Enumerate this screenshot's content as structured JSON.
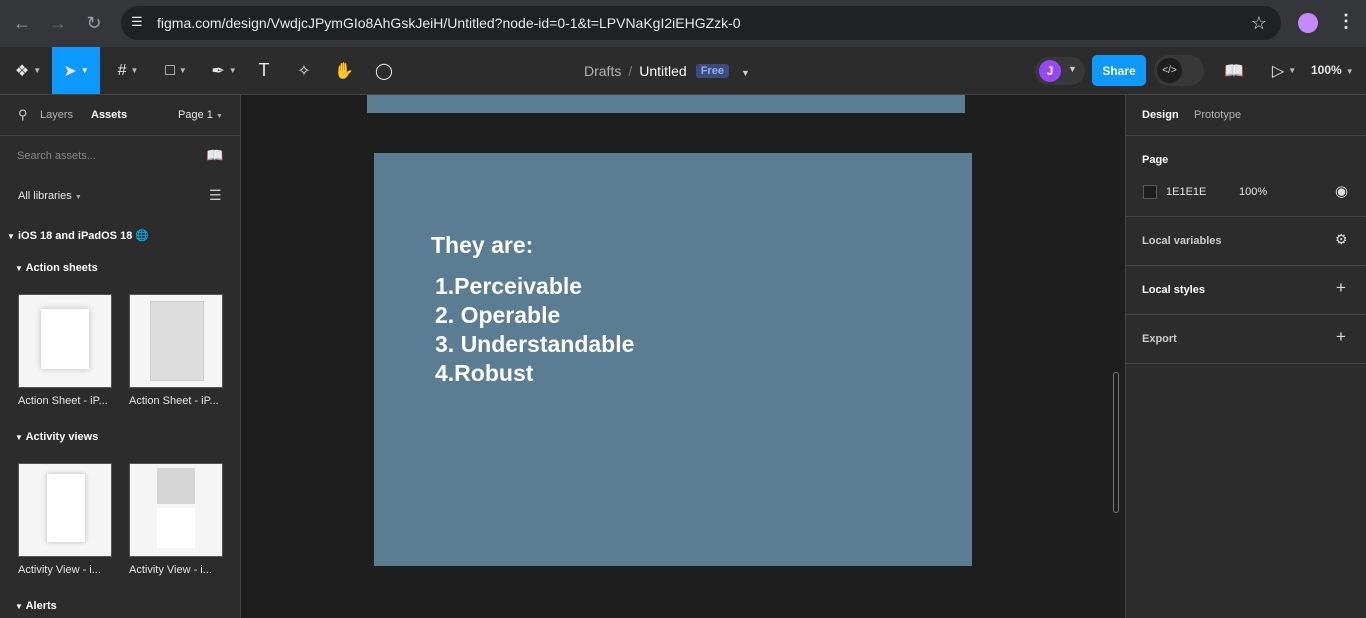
{
  "browser": {
    "url": "figma.com/design/VwdjcJPymGIo8AhGskJeiH/Untitled?node-id=0-1&t=LPVNaKgI2iEHGZzk-0"
  },
  "toolbar": {
    "breadcrumb_drafts": "Drafts",
    "breadcrumb_sep": "/",
    "file_title": "Untitled",
    "plan_badge": "Free",
    "user_initial": "J",
    "share_label": "Share",
    "zoom": "100%"
  },
  "left_panel": {
    "tab_layers": "Layers",
    "tab_assets": "Assets",
    "page_select": "Page 1",
    "search_placeholder": "Search assets...",
    "libraries_filter": "All libraries",
    "library_name": "iOS 18 and iPadOS 18",
    "sections": [
      {
        "title": "Action sheets",
        "items": [
          {
            "label": "Action Sheet - iP..."
          },
          {
            "label": "Action Sheet - iP..."
          }
        ]
      },
      {
        "title": "Activity views",
        "items": [
          {
            "label": "Activity View - i..."
          },
          {
            "label": "Activity View - i..."
          }
        ]
      },
      {
        "title": "Alerts",
        "items": []
      }
    ]
  },
  "canvas": {
    "frame_color": "#5a7d94",
    "heading": "They are:",
    "items": [
      "1.Perceivable",
      "2. Operable",
      "3. Understandable",
      "4.Robust"
    ]
  },
  "right_panel": {
    "tab_design": "Design",
    "tab_prototype": "Prototype",
    "page_section": "Page",
    "page_color_hex": "1E1E1E",
    "page_opacity": "100%",
    "local_variables": "Local variables",
    "local_styles": "Local styles",
    "export": "Export"
  }
}
